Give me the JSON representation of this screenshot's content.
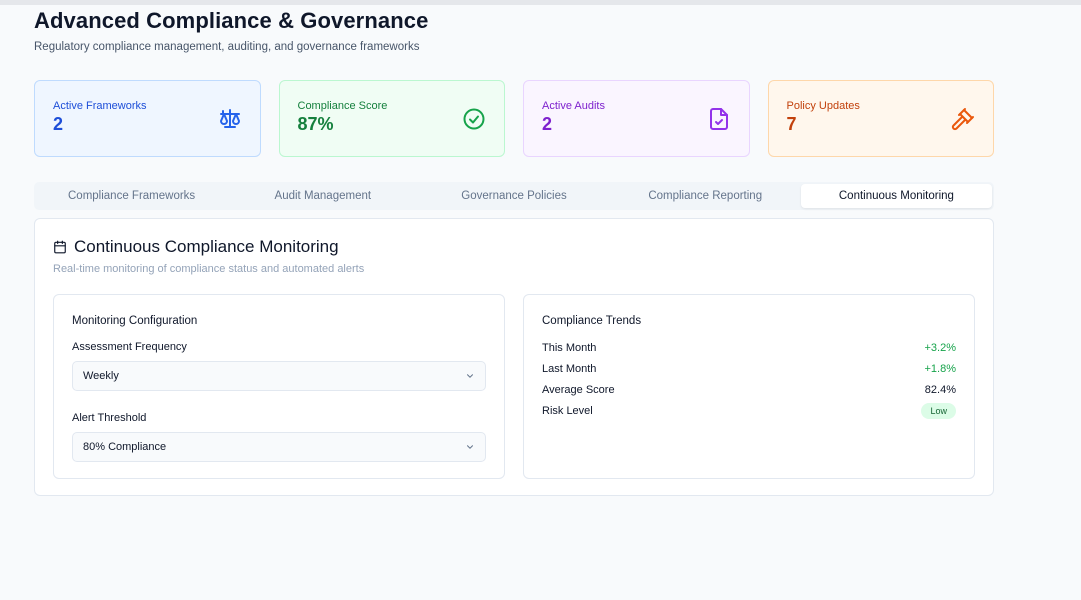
{
  "page": {
    "title": "Advanced Compliance & Governance",
    "subtitle": "Regulatory compliance management, auditing, and governance frameworks"
  },
  "stats": [
    {
      "label": "Active Frameworks",
      "value": "2",
      "icon": "scale-icon",
      "color": "#1d4ed8"
    },
    {
      "label": "Compliance Score",
      "value": "87%",
      "icon": "check-circle-icon",
      "color": "#15803d"
    },
    {
      "label": "Active Audits",
      "value": "2",
      "icon": "file-check-icon",
      "color": "#7e22ce"
    },
    {
      "label": "Policy Updates",
      "value": "7",
      "icon": "gavel-icon",
      "color": "#c2410c"
    }
  ],
  "tabs": [
    {
      "label": "Compliance Frameworks",
      "active": false
    },
    {
      "label": "Audit Management",
      "active": false
    },
    {
      "label": "Governance Policies",
      "active": false
    },
    {
      "label": "Compliance Reporting",
      "active": false
    },
    {
      "label": "Continuous Monitoring",
      "active": true
    }
  ],
  "panel": {
    "title": "Continuous Compliance Monitoring",
    "subtitle": "Real-time monitoring of compliance status and automated alerts",
    "icon": "calendar-icon"
  },
  "config": {
    "title": "Monitoring Configuration",
    "frequency_label": "Assessment Frequency",
    "frequency_value": "Weekly",
    "threshold_label": "Alert Threshold",
    "threshold_value": "80% Compliance"
  },
  "trends": {
    "title": "Compliance Trends",
    "rows": [
      {
        "label": "This Month",
        "value": "+3.2%"
      },
      {
        "label": "Last Month",
        "value": "+1.8%"
      },
      {
        "label": "Average Score",
        "value": "82.4%"
      },
      {
        "label": "Risk Level",
        "value": "Low"
      }
    ]
  },
  "colors": {
    "positive": "#16a34a",
    "badge_bg": "#dcfce7"
  }
}
